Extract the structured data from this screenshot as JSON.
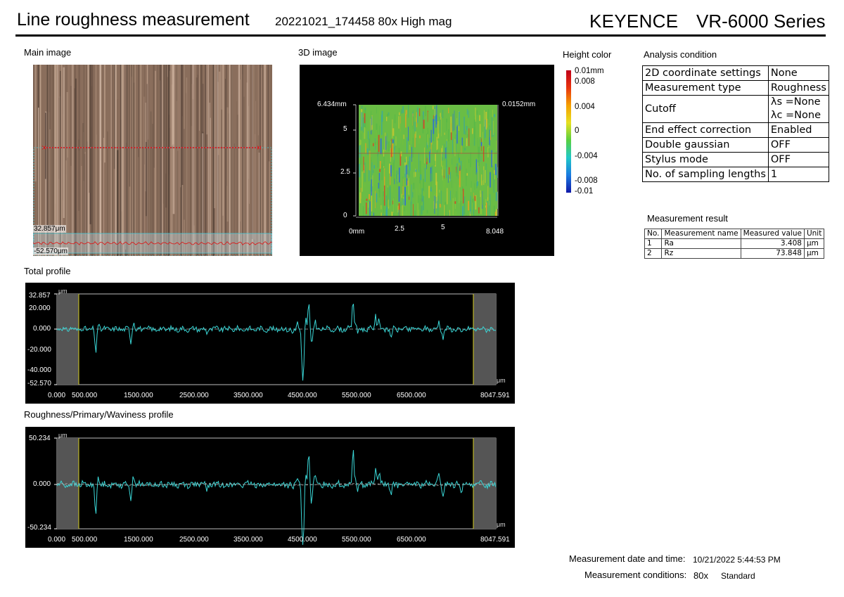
{
  "header": {
    "title": "Line roughness measurement",
    "subtitle": "20221021_174458 80x High mag",
    "brand": "KEYENCE",
    "series": "VR-6000 Series"
  },
  "main_image": {
    "label": "Main image",
    "scale_top": "32.857μm",
    "scale_bottom": "-52.570μm"
  },
  "image_3d": {
    "label": "3D image",
    "y_top_label": "6.434mm",
    "z_label": "0.0152mm",
    "y_ticks": [
      "5",
      "2.5",
      "0"
    ],
    "x_ticks": [
      "0mm",
      "2.5",
      "5",
      "8.048"
    ]
  },
  "height_color": {
    "label": "Height color",
    "ticks": [
      "0.01mm",
      "0.008",
      "0.004",
      "0",
      "-0.004",
      "-0.008",
      "-0.01"
    ],
    "colors": [
      "#c0001a",
      "#e8340e",
      "#f5a000",
      "#e7e020",
      "#58d040",
      "#20c8c8",
      "#1a7ae0",
      "#1018a8"
    ]
  },
  "analysis_condition": {
    "label": "Analysis condition",
    "rows": [
      {
        "name": "2D coordinate settings",
        "value": "None"
      },
      {
        "name": "Measurement type",
        "value": "Roughness"
      },
      {
        "name": "Cutoff",
        "value": "λs =None",
        "value2": "λc =None"
      },
      {
        "name": "End effect correction",
        "value": "Enabled"
      },
      {
        "name": "Double gaussian",
        "value": "OFF"
      },
      {
        "name": "Stylus mode",
        "value": "OFF"
      },
      {
        "name": "No. of sampling lengths",
        "value": "1"
      }
    ]
  },
  "measurement_result": {
    "label": "Measurement result",
    "headers": [
      "No.",
      "Measurement name",
      "Measured value",
      "Unit"
    ],
    "rows": [
      {
        "no": "1",
        "name": "Ra",
        "value": "3.408",
        "unit": "μm"
      },
      {
        "no": "2",
        "name": "Rz",
        "value": "73.848",
        "unit": "μm"
      }
    ]
  },
  "total_profile": {
    "label": "Total profile",
    "unit": "μm",
    "y_ticks": [
      "32.857",
      "20.000",
      "0.000",
      "-20.000",
      "-40.000",
      "-52.570"
    ],
    "x_ticks": [
      "0.000",
      "500.000",
      "1500.000",
      "2500.000",
      "3500.000",
      "4500.000",
      "5500.000",
      "6500.000",
      "8047.591"
    ],
    "x_unit": "μm"
  },
  "roughness_profile": {
    "label": "Roughness/Primary/Waviness profile",
    "unit": "μm",
    "y_ticks": [
      "50.234",
      "0.000",
      "-50.234"
    ],
    "x_ticks": [
      "0.000",
      "500.000",
      "1500.000",
      "2500.000",
      "3500.000",
      "4500.000",
      "5500.000",
      "6500.000",
      "8047.591"
    ],
    "x_unit": "μm"
  },
  "footer": {
    "datetime_label": "Measurement date and time:",
    "datetime_value": "10/21/2022 5:44:53 PM",
    "conditions_label": "Measurement conditions:",
    "conditions_mag": "80x",
    "conditions_mode": "Standard"
  },
  "colors": {
    "profile_line": "#3ad6d6",
    "marker_yellow": "#d8d020",
    "measure_line": "#e01010"
  }
}
